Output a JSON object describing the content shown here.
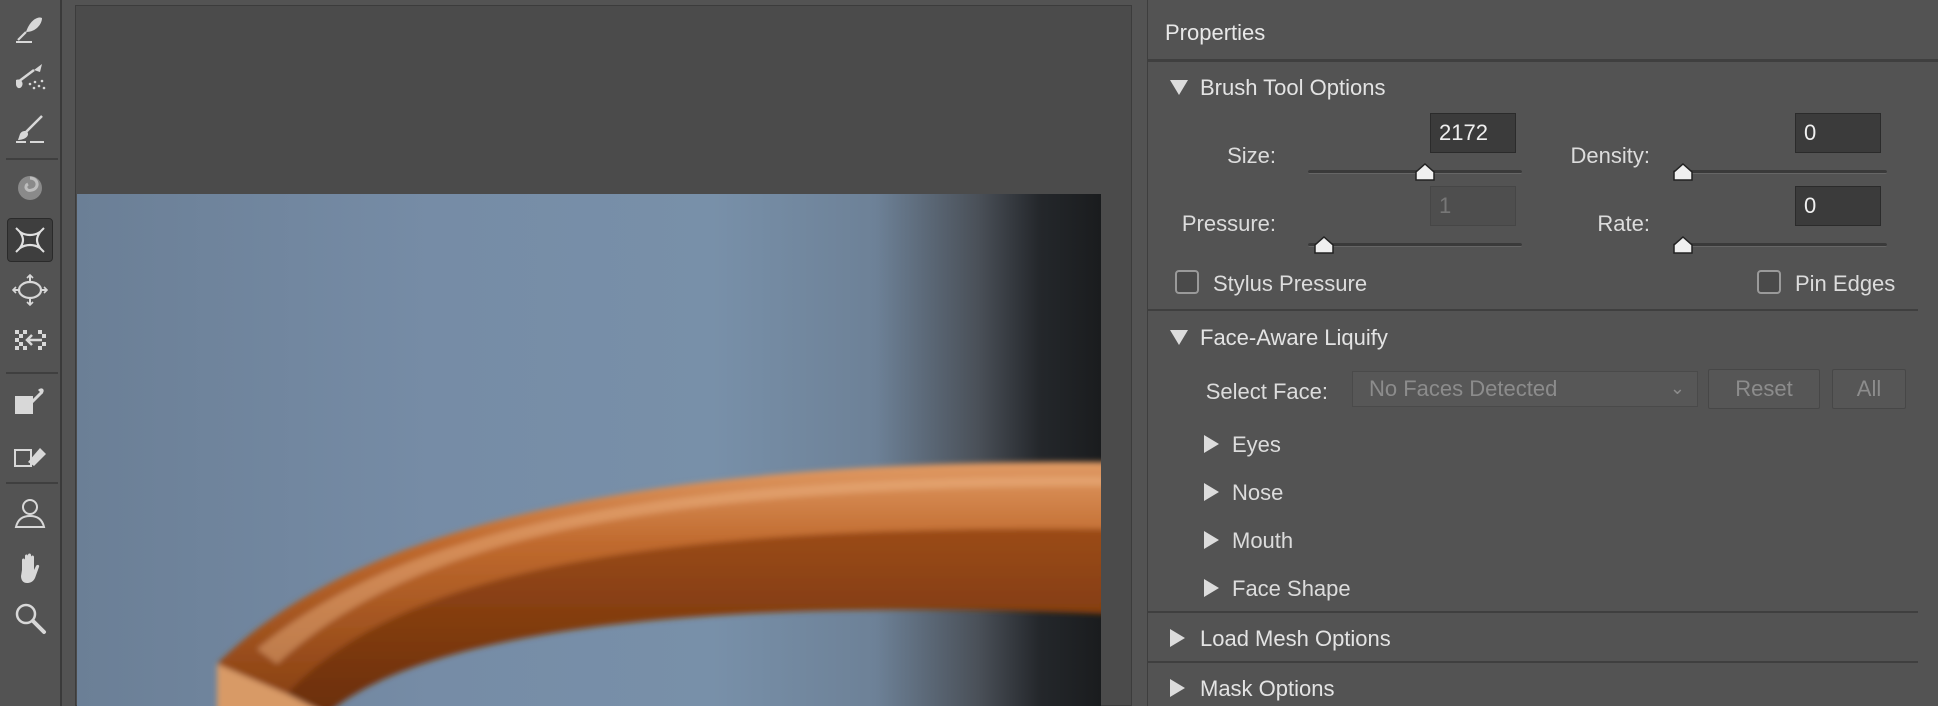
{
  "toolbar": {
    "tools": [
      {
        "name": "forward-warp-tool-icon"
      },
      {
        "name": "reconstruct-tool-icon"
      },
      {
        "name": "smooth-tool-icon"
      },
      {
        "name": "twirl-clockwise-tool-icon"
      },
      {
        "name": "pucker-tool-icon",
        "active": true
      },
      {
        "name": "bloat-tool-icon"
      },
      {
        "name": "push-left-tool-icon"
      },
      {
        "name": "freeze-mask-tool-icon"
      },
      {
        "name": "thaw-mask-tool-icon"
      },
      {
        "name": "face-tool-icon"
      },
      {
        "name": "hand-tool-icon"
      },
      {
        "name": "zoom-tool-icon"
      }
    ]
  },
  "panel": {
    "title": "Properties",
    "brush": {
      "heading": "Brush Tool Options",
      "size_label": "Size:",
      "size_value": "2172",
      "size_slider": 0.55,
      "density_label": "Density:",
      "density_value": "0",
      "density_slider": 0.0,
      "pressure_label": "Pressure:",
      "pressure_value": "1",
      "pressure_slider": 0.03,
      "rate_label": "Rate:",
      "rate_value": "0",
      "rate_slider": 0.0,
      "stylus_label": "Stylus Pressure",
      "stylus_checked": false,
      "pin_label": "Pin Edges",
      "pin_checked": false
    },
    "face": {
      "heading": "Face-Aware Liquify",
      "select_label": "Select Face:",
      "select_value": "No Faces Detected",
      "reset_label": "Reset",
      "all_label": "All",
      "items": [
        "Eyes",
        "Nose",
        "Mouth",
        "Face Shape"
      ]
    },
    "load_mesh": "Load Mesh Options",
    "mask": "Mask Options"
  },
  "colors": {
    "panel_bg": "#535353",
    "canvas_bg": "#4b4b4b",
    "text": "#dcdcdc"
  }
}
